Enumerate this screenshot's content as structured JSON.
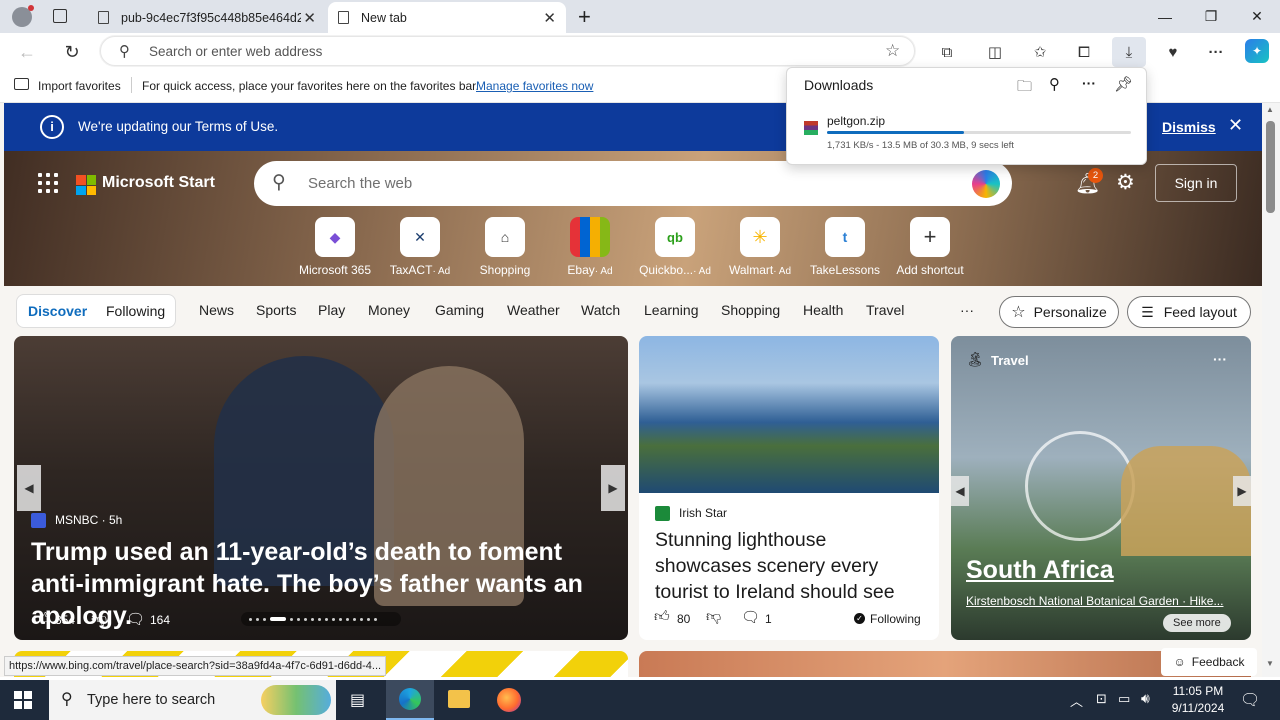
{
  "browser": {
    "tabs": [
      {
        "title": "pub-9c4ec7f3f95c448b85e464d2t",
        "active": false
      },
      {
        "title": "New tab",
        "active": true
      }
    ],
    "address_placeholder": "Search or enter web address",
    "favorites_bar": {
      "import_label": "Import favorites",
      "message": "For quick access, place your favorites here on the favorites bar.",
      "manage_link": "Manage favorites now"
    }
  },
  "downloads": {
    "title": "Downloads",
    "file_name": "peltgon.zip",
    "status": "1,731 KB/s - 13.5 MB of 30.3 MB, 9 secs left",
    "progress_fraction": 0.45
  },
  "banner": {
    "message": "We're updating our Terms of Use.",
    "dismiss": "Dismiss"
  },
  "start": {
    "brand": "Microsoft Start",
    "search_placeholder": "Search the web",
    "notification_count": "2",
    "sign_in": "Sign in",
    "shortcuts": [
      {
        "label": "Microsoft 365",
        "ad": ""
      },
      {
        "label": "TaxACT",
        "ad": "· Ad"
      },
      {
        "label": "Shopping",
        "ad": ""
      },
      {
        "label": "Ebay",
        "ad": "· Ad"
      },
      {
        "label": "Quickbo...",
        "ad": "· Ad"
      },
      {
        "label": "Walmart",
        "ad": "· Ad"
      },
      {
        "label": "TakeLessons",
        "ad": ""
      },
      {
        "label": "Add shortcut",
        "ad": ""
      }
    ]
  },
  "nav": {
    "discover": "Discover",
    "following": "Following",
    "items": [
      "News",
      "Sports",
      "Play",
      "Money",
      "Gaming",
      "Weather",
      "Watch",
      "Learning",
      "Shopping",
      "Health",
      "Travel"
    ],
    "more": "···",
    "personalize": "Personalize",
    "feed_layout": "Feed layout"
  },
  "hero": {
    "source": "MSNBC · 5h",
    "title": "Trump used an 11-year-old’s death to foment anti-immigrant hate. The boy’s father wants an apology.",
    "likes": "354",
    "comments": "164"
  },
  "ireland": {
    "source": "Irish Star",
    "title": "Stunning lighthouse showcases scenery every tourist to Ireland should see",
    "likes": "80",
    "comments": "1",
    "following": "Following"
  },
  "travel": {
    "category": "Travel",
    "title": "South Africa",
    "subtitle": "Kirstenbosch National Botanical Garden · Hike...",
    "see_more": "See more"
  },
  "feedback": "Feedback",
  "status_url": "https://www.bing.com/travel/place-search?sid=38a9fd4a-4f7c-6d91-d6dd-4...",
  "taskbar": {
    "search_placeholder": "Type here to search",
    "time": "11:05 PM",
    "date": "9/11/2024"
  },
  "colors": {
    "banner": "#0d3a9b",
    "accent": "#0f6cbd",
    "taskbar": "#1e2a3b"
  }
}
